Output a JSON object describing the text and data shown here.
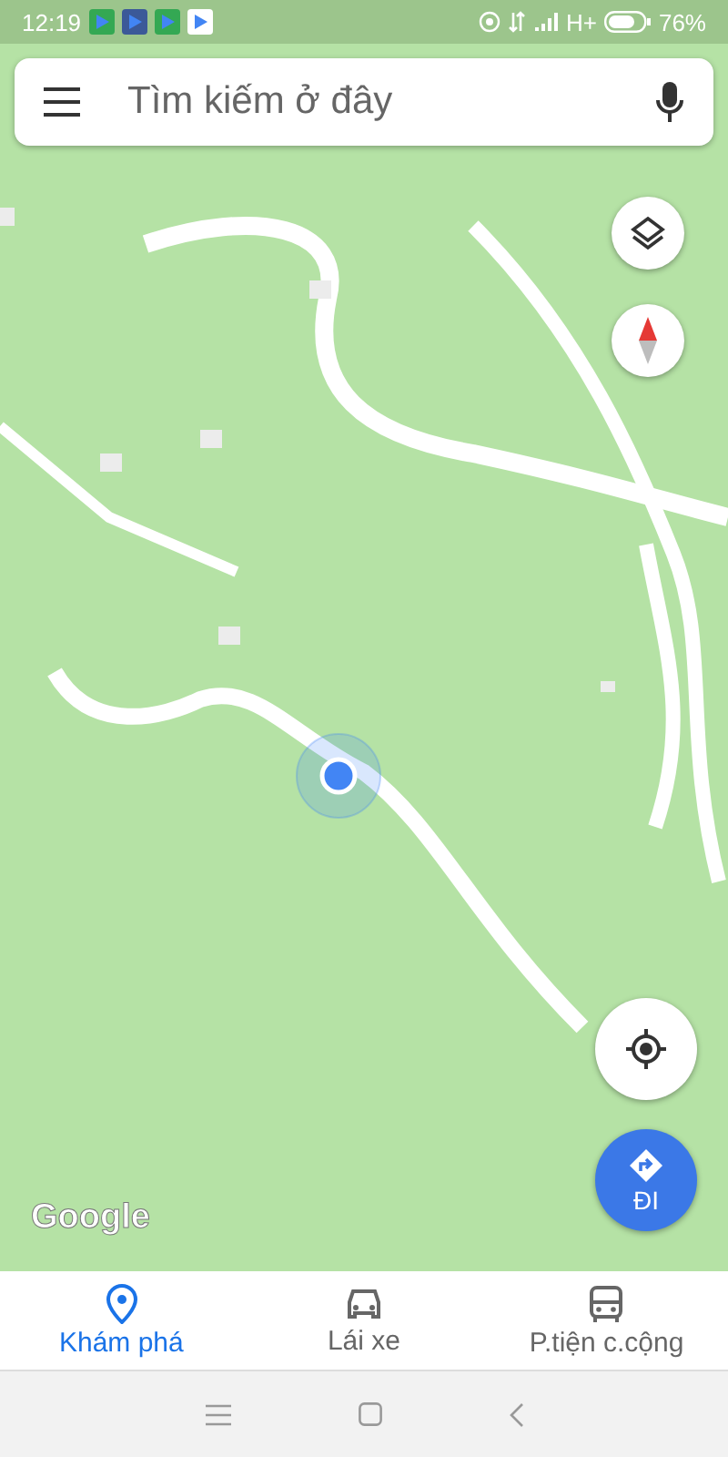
{
  "status_bar": {
    "time": "12:19",
    "network": "H+",
    "battery": "76%"
  },
  "search": {
    "placeholder": "Tìm kiếm ở đây"
  },
  "map": {
    "kind": "picture",
    "attribution": "Google",
    "directions_button": "ĐI"
  },
  "bottom_nav": [
    {
      "label": "Khám phá",
      "kind": "explore",
      "selected": true
    },
    {
      "label": "Lái xe",
      "kind": "car",
      "selected": false
    },
    {
      "label": "P.tiện c.cộng",
      "kind": "bus",
      "selected": false
    }
  ]
}
